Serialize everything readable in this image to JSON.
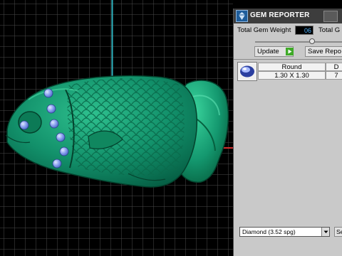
{
  "panel": {
    "title": "GEM REPORTER",
    "total_gem_weight_label": "Total Gem Weight",
    "total_gem_weight_value": "06",
    "total_gem_label_partial": "Total G",
    "slider_level": 0.65,
    "update_label": "Update",
    "save_report_label": "Save Repo",
    "table": {
      "columns": [
        "Round",
        "D"
      ],
      "rows": [
        {
          "size": "1.30 X 1.30",
          "d": "7"
        }
      ]
    },
    "material_select": {
      "selected": "Diamond      (3.52 spg)"
    },
    "material_next_label": "Se"
  },
  "colors": {
    "viewport_bg": "#000000",
    "grid_line": "#5b5b5b",
    "axis_vertical": "#2fb5c0",
    "axis_horizontal": "#d23030",
    "model_green": "#0f8a63",
    "gem_blue": "#7a92e8",
    "panel_bg": "#c9c9c9",
    "panel_header": "#3d3d3d",
    "play_green": "#3faa28"
  },
  "icons": {
    "logo": "gem-reporter-logo-icon",
    "play": "play-icon",
    "dropdown": "chevron-down-icon",
    "gem": "round-gem-icon"
  }
}
